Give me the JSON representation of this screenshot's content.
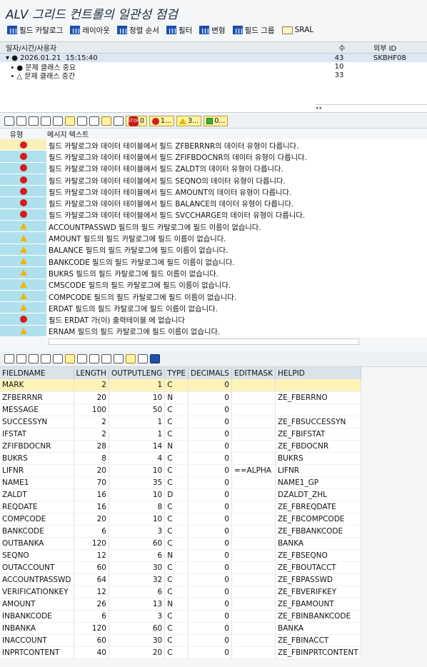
{
  "title": "ALV 그리드 컨트롤의 일관성 점검",
  "toolbar": [
    {
      "label": "필드 카탈로그",
      "icon": "grid-icon"
    },
    {
      "label": "레이아웃",
      "icon": "grid-icon"
    },
    {
      "label": "정렬 순서",
      "icon": "grid-icon"
    },
    {
      "label": "필터",
      "icon": "grid-icon"
    },
    {
      "label": "변형",
      "icon": "grid-icon"
    },
    {
      "label": "필드 그룹",
      "icon": "grid-icon"
    },
    {
      "label": "SRAL",
      "icon": "folder-icon"
    }
  ],
  "summary": {
    "headers": [
      "일자/시간/사용자",
      "수",
      "외부 ID"
    ],
    "rows": [
      {
        "label": "▾ ● 2026.01.21  15:15:40",
        "count": "43",
        "ext": "SKBHF08"
      },
      {
        "label": "  • ● 문제 클래스 중요",
        "count": "10",
        "ext": ""
      },
      {
        "label": "  • △ 문제 클래스 중간",
        "count": "33",
        "ext": ""
      }
    ]
  },
  "msg_toolbar": {
    "stop_count": "0",
    "red_count": "1...",
    "yellow_count": "3...",
    "green_count": "0..."
  },
  "messages": {
    "headers": [
      "유형",
      "메시지 텍스트"
    ],
    "rows": [
      {
        "type": "error",
        "text": "필드 카탈로그와 데이터 테이블에서 필드 ZFBERRNR의 데이터 유형이 다릅니다."
      },
      {
        "type": "error",
        "text": "필드 카탈로그와 데이터 테이블에서 필드 ZFIFBDOCNR의 데이터 유형이 다릅니다."
      },
      {
        "type": "error",
        "text": "필드 카탈로그와 데이터 테이블에서 필드 ZALDT의 데이터 유형이 다릅니다."
      },
      {
        "type": "error",
        "text": "필드 카탈로그와 데이터 테이블에서 필드 SEQNO의 데이터 유형이 다릅니다."
      },
      {
        "type": "error",
        "text": "필드 카탈로그와 데이터 테이블에서 필드 AMOUNT의 데이터 유형이 다릅니다."
      },
      {
        "type": "error",
        "text": "필드 카탈로그와 데이터 테이블에서 필드 BALANCE의 데이터 유형이 다릅니다."
      },
      {
        "type": "error",
        "text": "필드 카탈로그와 데이터 테이블에서 필드 SVCCHARGE의 데이터 유형이 다릅니다."
      },
      {
        "type": "warning",
        "text": "ACCOUNTPASSWD 필드의 필드 카탈로그에 필드 이름이 없습니다."
      },
      {
        "type": "warning",
        "text": "AMOUNT 필드의 필드 카탈로그에 필드 이름이 없습니다."
      },
      {
        "type": "warning",
        "text": "BALANCE 필드의 필드 카탈로그에 필드 이름이 없습니다."
      },
      {
        "type": "warning",
        "text": "BANKCODE 필드의 필드 카탈로그에 필드 이름이 없습니다."
      },
      {
        "type": "warning",
        "text": "BUKRS 필드의 필드 카탈로그에 필드 이름이 없습니다."
      },
      {
        "type": "warning",
        "text": "CMSCODE 필드의 필드 카탈로그에 필드 이름이 없습니다."
      },
      {
        "type": "warning",
        "text": "COMPCODE 필드의 필드 카탈로그에 필드 이름이 없습니다."
      },
      {
        "type": "warning",
        "text": "ERDAT 필드의 필드 카탈로그에 필드 이름이 없습니다."
      },
      {
        "type": "error",
        "text": "필드 ERDAT 가(이) 출력테이블  에 없습니다"
      },
      {
        "type": "warning",
        "text": "ERNAM 필드의 필드 카탈로그에 필드 이름이 없습니다."
      }
    ]
  },
  "fields": {
    "headers": [
      "FIELDNAME",
      "LENGTH",
      "OUTPUTLENG",
      "TYPE",
      "DECIMALS",
      "EDITMASK",
      "HELPID"
    ],
    "rows": [
      [
        "MARK",
        "2",
        "1",
        "C",
        "0",
        "",
        ""
      ],
      [
        "ZFBERRNR",
        "20",
        "10",
        "N",
        "0",
        "",
        "ZE_FBERRNO"
      ],
      [
        "MESSAGE",
        "100",
        "50",
        "C",
        "0",
        "",
        ""
      ],
      [
        "SUCCESSYN",
        "2",
        "1",
        "C",
        "0",
        "",
        "ZE_FBSUCCESSYN"
      ],
      [
        "IFSTAT",
        "2",
        "1",
        "C",
        "0",
        "",
        "ZE_FBIFSTAT"
      ],
      [
        "ZFIFBDOCNR",
        "28",
        "14",
        "N",
        "0",
        "",
        "ZE_FBDOCNR"
      ],
      [
        "BUKRS",
        "8",
        "4",
        "C",
        "0",
        "",
        "BUKRS"
      ],
      [
        "LIFNR",
        "20",
        "10",
        "C",
        "0",
        "==ALPHA",
        "LIFNR"
      ],
      [
        "NAME1",
        "70",
        "35",
        "C",
        "0",
        "",
        "NAME1_GP"
      ],
      [
        "ZALDT",
        "16",
        "10",
        "D",
        "0",
        "",
        "DZALDT_ZHL"
      ],
      [
        "REQDATE",
        "16",
        "8",
        "C",
        "0",
        "",
        "ZE_FBREQDATE"
      ],
      [
        "COMPCODE",
        "20",
        "10",
        "C",
        "0",
        "",
        "ZE_FBCOMPCODE"
      ],
      [
        "BANKCODE",
        "6",
        "3",
        "C",
        "0",
        "",
        "ZE_FBBANKCODE"
      ],
      [
        "OUTBANKA",
        "120",
        "60",
        "C",
        "0",
        "",
        "BANKA"
      ],
      [
        "SEQNO",
        "12",
        "6",
        "N",
        "0",
        "",
        "ZE_FBSEQNO"
      ],
      [
        "OUTACCOUNT",
        "60",
        "30",
        "C",
        "0",
        "",
        "ZE_FBOUTACCT"
      ],
      [
        "ACCOUNTPASSWD",
        "64",
        "32",
        "C",
        "0",
        "",
        "ZE_FBPASSWD"
      ],
      [
        "VERIFICATIONKEY",
        "12",
        "6",
        "C",
        "0",
        "",
        "ZE_FBVERIFKEY"
      ],
      [
        "AMOUNT",
        "26",
        "13",
        "N",
        "0",
        "",
        "ZE_FBAMOUNT"
      ],
      [
        "INBANKCODE",
        "6",
        "3",
        "C",
        "0",
        "",
        "ZE_FBINBANKCODE"
      ],
      [
        "INBANKA",
        "120",
        "60",
        "C",
        "0",
        "",
        "BANKA"
      ],
      [
        "INACCOUNT",
        "60",
        "30",
        "C",
        "0",
        "",
        "ZE_FBINACCT"
      ],
      [
        "INPRTCONTENT",
        "40",
        "20",
        "C",
        "0",
        "",
        "ZE_FBINPRTCONTENT"
      ]
    ]
  }
}
